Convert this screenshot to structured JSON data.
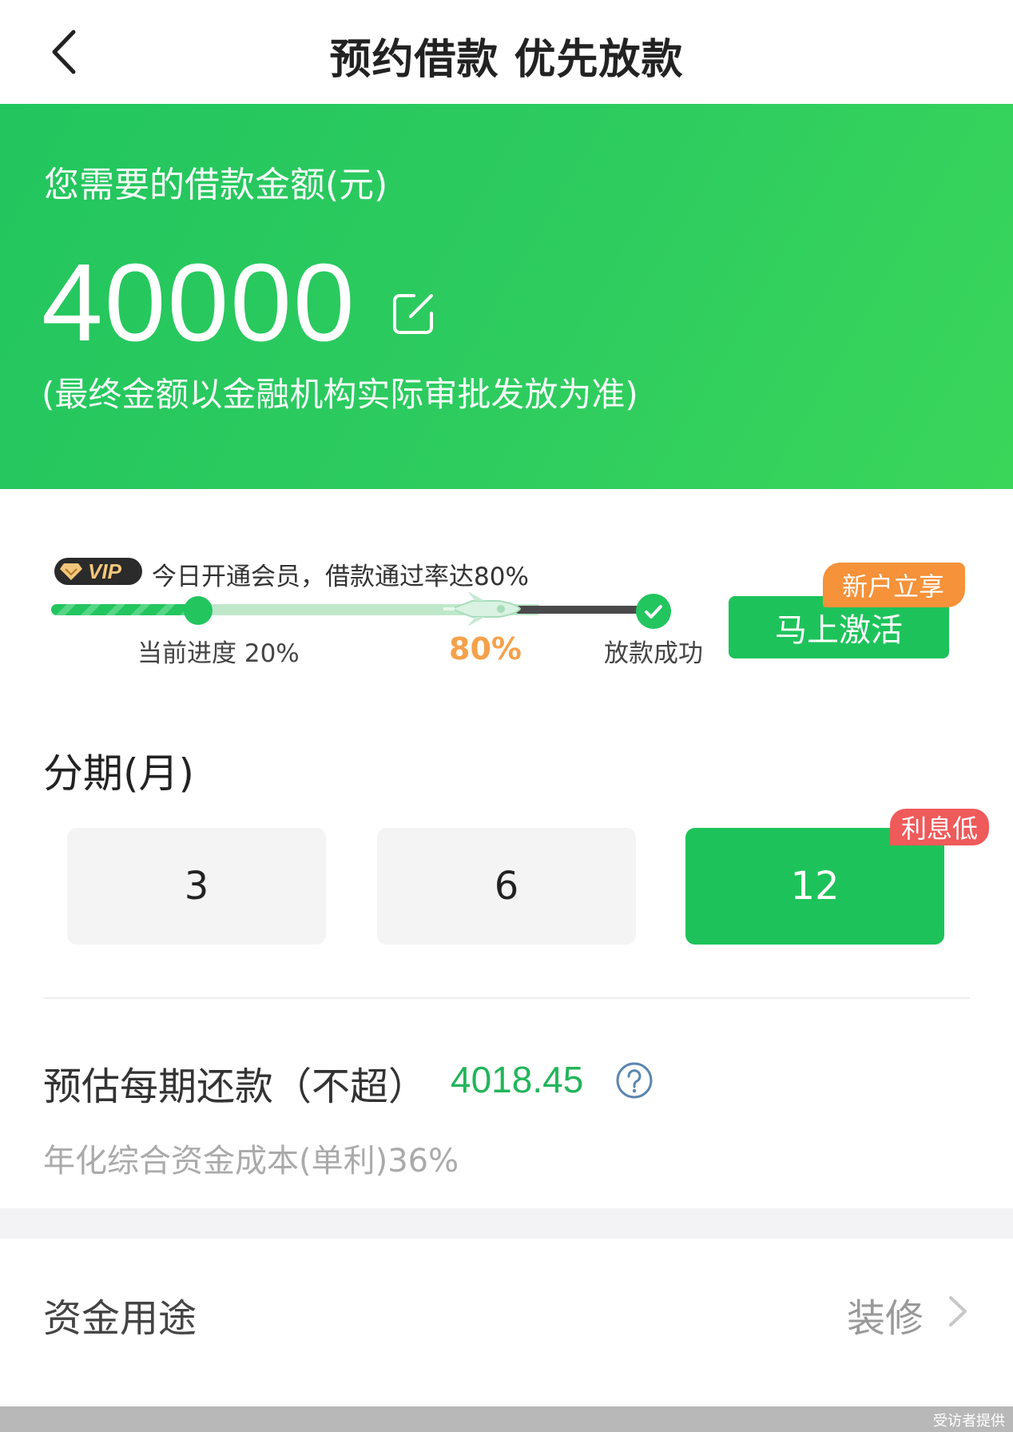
{
  "header": {
    "title": "预约借款 优先放款",
    "back_icon": "chevron-left-icon"
  },
  "hero": {
    "label": "您需要的借款金额(元)",
    "amount": "40000",
    "edit_icon": "edit-icon",
    "note": "(最终金额以金融机构实际审批发放为准)",
    "bg_color": "#22c55e"
  },
  "vip": {
    "badge": "VIP",
    "promo_text": "今日开通会员，借款通过率达80%",
    "progress_label": "当前进度 20%",
    "target_label": "80%",
    "success_label": "放款成功",
    "current_progress": 0.2,
    "activate_button": "马上激活",
    "new_user_tag": "新户立享"
  },
  "installments": {
    "title": "分期(月)",
    "options": [
      "3",
      "6",
      "12"
    ],
    "selected": "12",
    "tag": "利息低"
  },
  "estimate": {
    "label": "预估每期还款（不超）",
    "value": "4018.45",
    "rate_note": "年化综合资金成本(单利)36%"
  },
  "purpose": {
    "label": "资金用途",
    "value": "装修"
  },
  "footer": {
    "credit": "受访者提供"
  },
  "colors": {
    "accent": "#1dc35a",
    "orange": "#f5923a",
    "red_tag": "#ef5a5a",
    "value_green": "#22b55a"
  }
}
